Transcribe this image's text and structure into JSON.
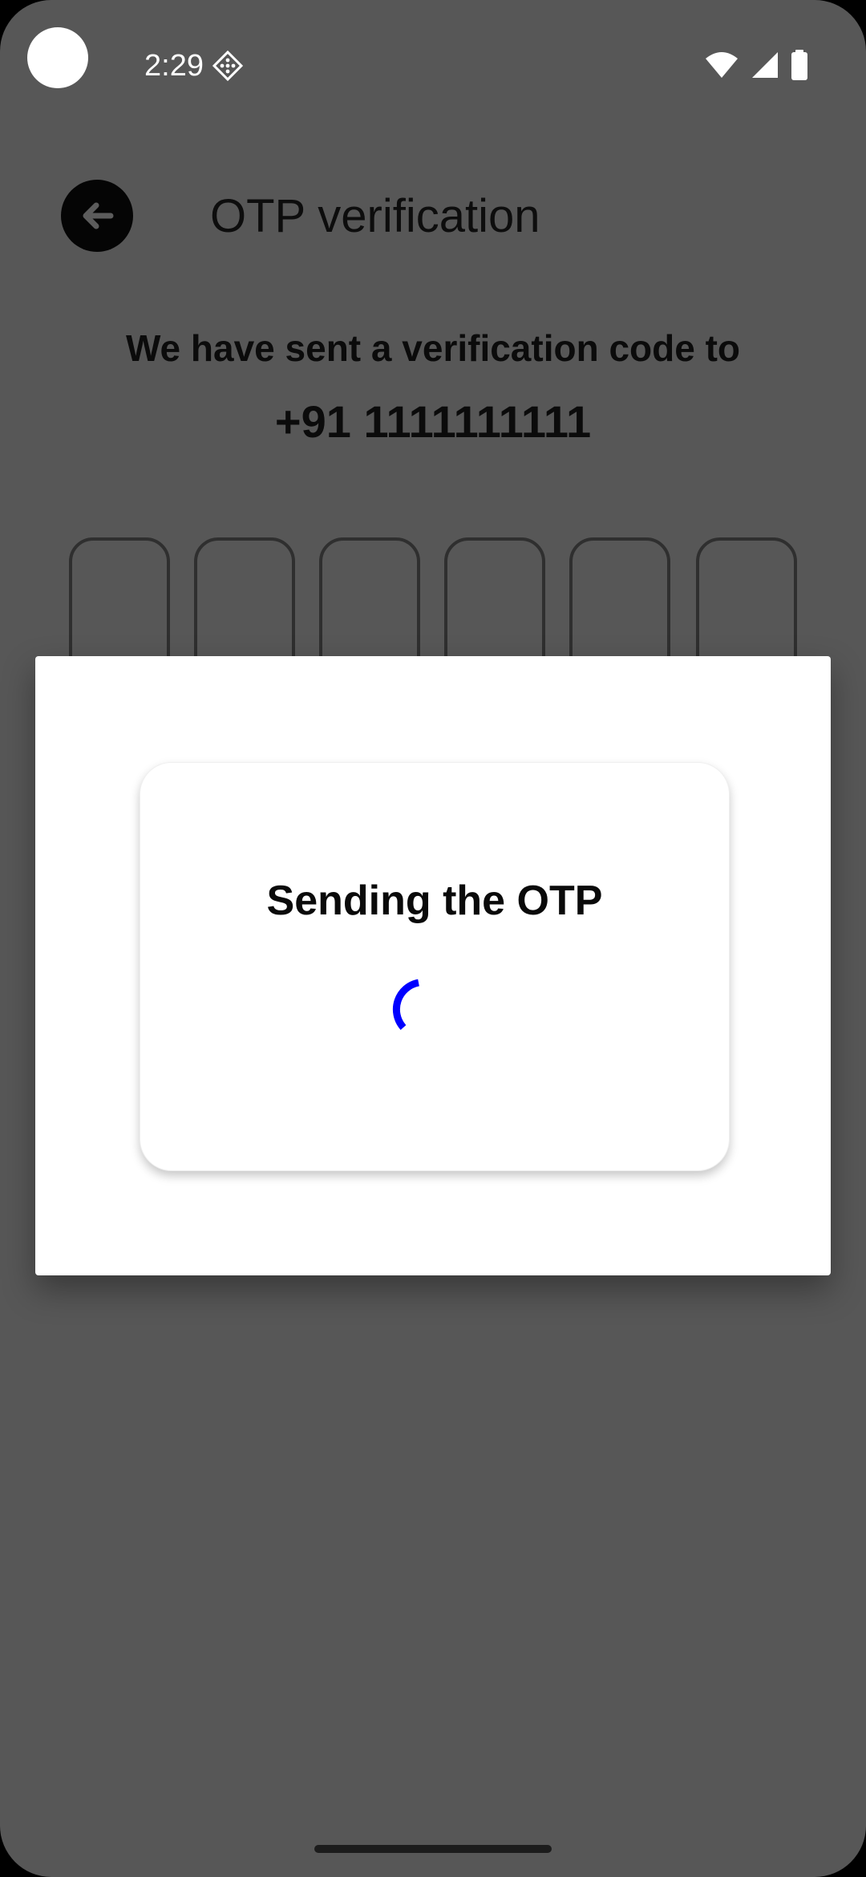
{
  "status_bar": {
    "time": "2:29",
    "app_icon": "dice-icon",
    "icons": [
      "wifi-icon",
      "signal-icon",
      "battery-icon"
    ]
  },
  "header": {
    "back_icon": "arrow-left-icon",
    "title": "OTP verification"
  },
  "content": {
    "sent_message": "We have sent a verification code to",
    "phone_number": "+91 1111111111",
    "otp_digits": [
      "",
      "",
      "",
      "",
      "",
      ""
    ]
  },
  "dialog": {
    "title": "Sending the OTP",
    "spinner_color": "#0000ff"
  },
  "colors": {
    "background": "#575757",
    "dialog": "#ffffff",
    "accent": "#0000ff"
  }
}
